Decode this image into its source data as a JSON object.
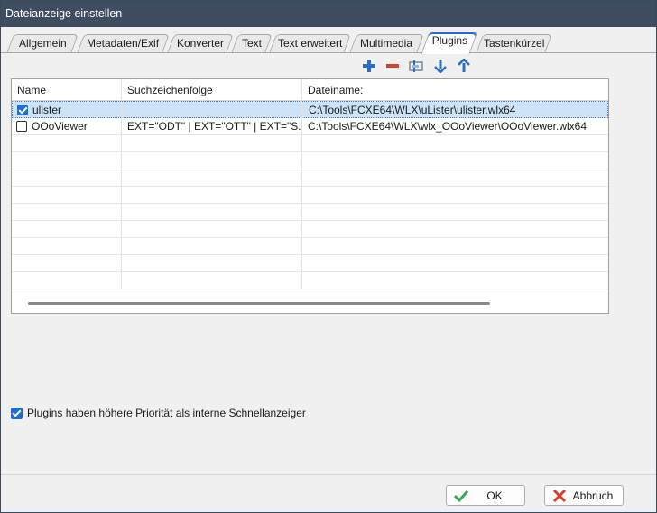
{
  "window": {
    "title": "Dateianzeige einstellen"
  },
  "tabs": [
    {
      "label": "Allgemein"
    },
    {
      "label": "Metadaten/Exif"
    },
    {
      "label": "Konverter"
    },
    {
      "label": "Text"
    },
    {
      "label": "Text erweitert"
    },
    {
      "label": "Multimedia"
    },
    {
      "label": "Plugins",
      "active": true
    },
    {
      "label": "Tastenkürzel"
    }
  ],
  "toolbar": {
    "icons": [
      "add-icon",
      "remove-icon",
      "configure-icon",
      "move-down-icon",
      "move-up-icon"
    ],
    "accent": "#2b6fc0",
    "remove_color": "#d8402c"
  },
  "grid": {
    "headers": [
      "Name",
      "Suchzeichenfolge",
      "Dateiname:"
    ],
    "rows": [
      {
        "checked": true,
        "name": "ulister",
        "search": "",
        "file": "C:\\Tools\\FCXE64\\WLX\\uLister\\ulister.wlx64",
        "selected": true
      },
      {
        "checked": false,
        "name": "OOoViewer",
        "search": "EXT=\"ODT\" | EXT=\"OTT\" | EXT=\"S...",
        "file": "C:\\Tools\\FCXE64\\WLX\\wlx_OOoViewer\\OOoViewer.wlx64",
        "selected": false
      }
    ]
  },
  "option": {
    "label": "Plugins haben höhere Priorität als interne Schnellanzeiger",
    "checked": true
  },
  "buttons": {
    "ok": "OK",
    "cancel": "Abbruch"
  },
  "colors": {
    "titlebar": "#3e4d5f",
    "checkbox": "#1f6fd0",
    "ok_icon": "#3aa757",
    "cancel_icon": "#d8402c"
  }
}
